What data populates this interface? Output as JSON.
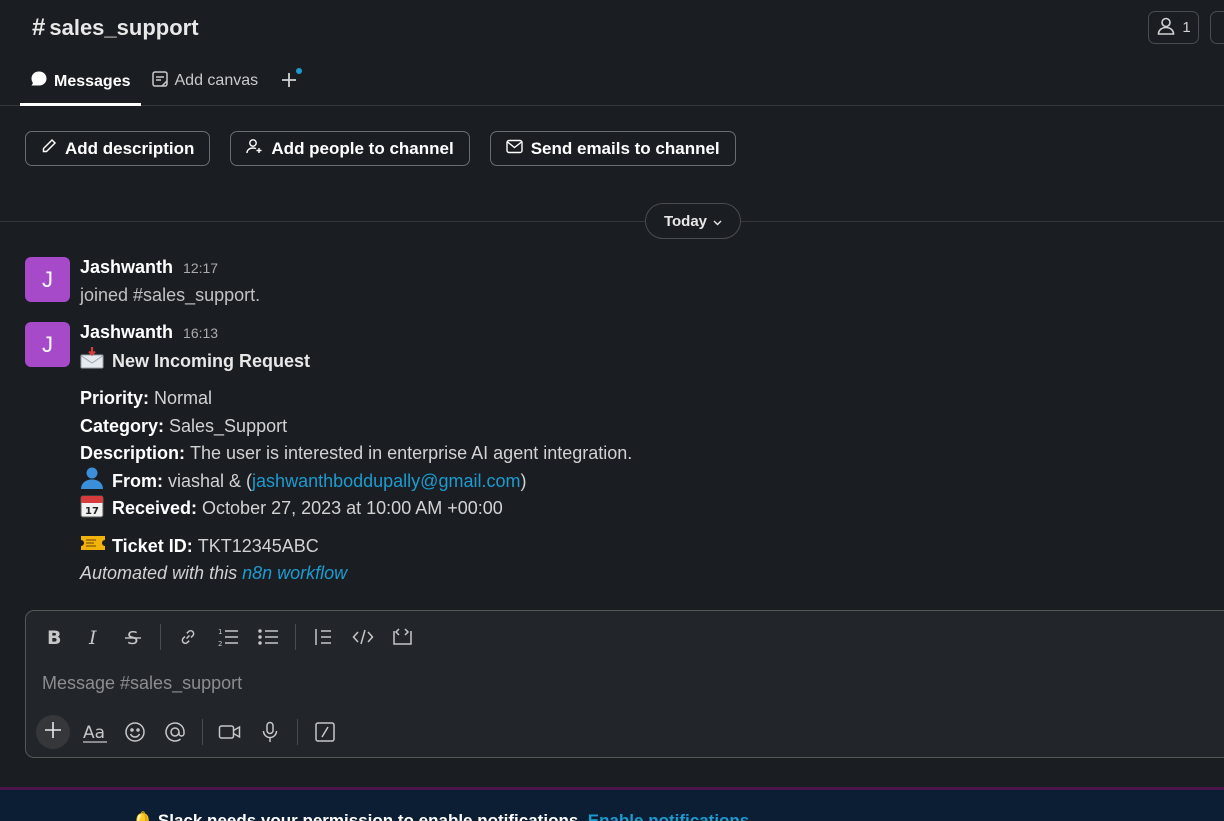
{
  "header": {
    "channel_name": "sales_support",
    "hash": "#",
    "member_count": "1"
  },
  "tabs": [
    {
      "label": "Messages",
      "icon": "message-bubble-icon"
    },
    {
      "label": "Add canvas",
      "icon": "canvas-icon"
    }
  ],
  "actions": [
    {
      "label": "Add description",
      "icon": "pencil-icon"
    },
    {
      "label": "Add people to channel",
      "icon": "add-person-icon"
    },
    {
      "label": "Send emails to channel",
      "icon": "email-icon"
    }
  ],
  "date_divider": "Today",
  "messages": [
    {
      "author": "Jashwanth",
      "avatar_initial": "J",
      "time": "12:17",
      "text": "joined #sales_support."
    },
    {
      "author": "Jashwanth",
      "avatar_initial": "J",
      "time": "16:13",
      "title": "New Incoming Request",
      "priority_label": "Priority:",
      "priority_value": "Normal",
      "category_label": "Category:",
      "category_value": "Sales_Support",
      "description_label": "Description:",
      "description_value": "The user is interested in enterprise AI agent integration.",
      "from_label": "From:",
      "from_name": "viashal & (",
      "from_email": "jashwanthboddupally@gmail.com",
      "from_close": ")",
      "received_label": "Received:",
      "received_value": "October 27, 2023 at 10:00 AM +00:00",
      "ticket_label": "Ticket ID:",
      "ticket_value": "TKT12345ABC",
      "footer_text": "Automated with this ",
      "footer_link": "n8n workflow"
    }
  ],
  "composer": {
    "placeholder": "Message #sales_support"
  },
  "banner": {
    "text": "Slack needs your permission to enable notifications.",
    "link": "Enable notifications"
  },
  "colors": {
    "background": "#1a1d21",
    "avatar": "#a64ac9",
    "link": "#1d9bd1",
    "banner": "#0b1e33"
  }
}
